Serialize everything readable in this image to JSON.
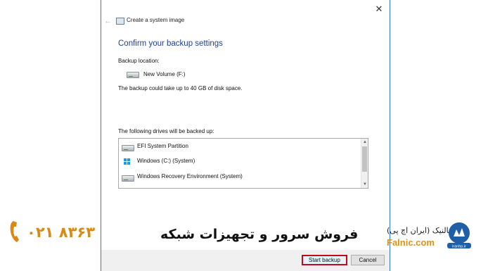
{
  "dialog": {
    "title": "Create a system image",
    "close_glyph": "✕",
    "back_glyph": "←",
    "heading": "Confirm your backup settings",
    "backup_location_label": "Backup location:",
    "backup_location_name": "New Volume (F:)",
    "space_note": "The backup could take up to 40 GB of disk space.",
    "drives_label": "The following drives will be backed up:",
    "drives": [
      {
        "label": "EFI System Partition",
        "icon": "drive-icon"
      },
      {
        "label": "Windows (C:) (System)",
        "icon": "windows-icon"
      },
      {
        "label": "Windows Recovery Environment (System)",
        "icon": "drive-icon"
      }
    ],
    "scroll_up_glyph": "▲",
    "scroll_down_glyph": "▼",
    "buttons": {
      "start": "Start backup",
      "cancel": "Cancel"
    }
  },
  "overlay": {
    "brand_text": "فروش سرور و تجهیزات شبکه",
    "phone": "۰۲۱ ۸۳۶۳",
    "logo_fa": "فالنیک (ایران اچ پی)",
    "logo_en": "Falnic.com",
    "logo_badge_text": "iranhp.ir"
  },
  "colors": {
    "accent_border": "#2e7bd1",
    "heading": "#1f3f8f",
    "highlight": "#c00b19",
    "brand_orange": "#d98a14"
  }
}
